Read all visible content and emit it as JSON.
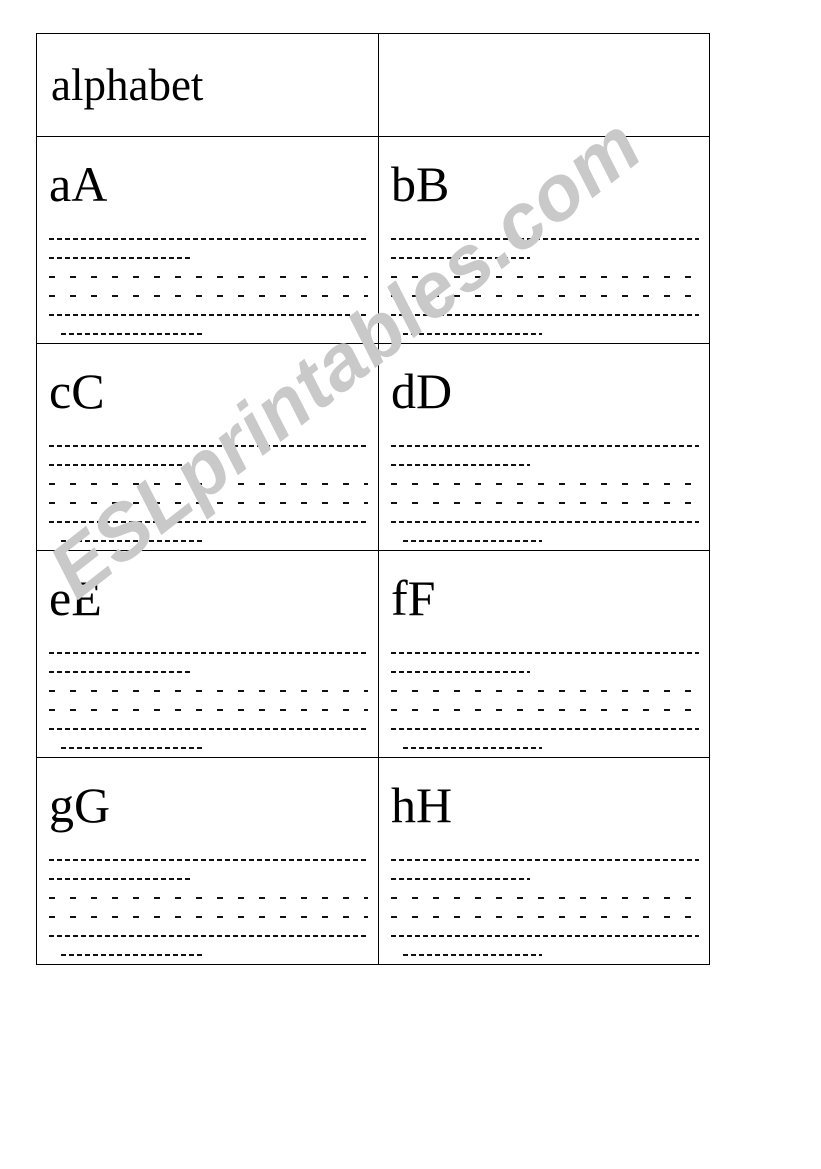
{
  "page": {
    "background_color": "#ffffff",
    "worksheet_type": "alphabet handwriting tracing worksheet"
  },
  "watermark": {
    "text": "ESLprintables.com",
    "color": "#c9c9c9",
    "rotation_deg": -38
  },
  "table": {
    "border_color": "#000000",
    "header_background": "#b4b4b4",
    "header": {
      "title": "alphabet",
      "second_cell": ""
    },
    "rows": [
      {
        "left": {
          "letters": "aA"
        },
        "right": {
          "letters": "bB"
        }
      },
      {
        "left": {
          "letters": "cC"
        },
        "right": {
          "letters": "dD"
        }
      },
      {
        "left": {
          "letters": "eE"
        },
        "right": {
          "letters": "fF"
        }
      },
      {
        "left": {
          "letters": "gG"
        },
        "right": {
          "letters": "hH"
        }
      }
    ],
    "trace_line_pattern": [
      {
        "style": "tight",
        "width": "full"
      },
      {
        "style": "tight",
        "width": "short"
      },
      {
        "style": "sparse",
        "width": "full"
      },
      {
        "style": "sparse",
        "width": "full"
      },
      {
        "style": "tight",
        "width": "full"
      },
      {
        "style": "tight",
        "width": "short",
        "indent": true
      }
    ]
  }
}
